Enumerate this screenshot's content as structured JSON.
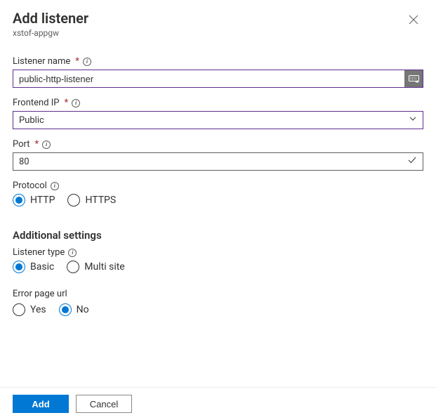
{
  "header": {
    "title": "Add listener",
    "subtitle": "xstof-appgw"
  },
  "fields": {
    "listenerName": {
      "label": "Listener name",
      "required": "*",
      "value": "public-http-listener"
    },
    "frontendIp": {
      "label": "Frontend IP",
      "required": "*",
      "value": "Public"
    },
    "port": {
      "label": "Port",
      "required": "*",
      "value": "80"
    },
    "protocol": {
      "label": "Protocol",
      "options": {
        "http": "HTTP",
        "https": "HTTPS"
      },
      "selected": "http"
    }
  },
  "section": {
    "heading": "Additional settings",
    "listenerType": {
      "label": "Listener type",
      "options": {
        "basic": "Basic",
        "multisite": "Multi site"
      },
      "selected": "basic"
    },
    "errorPageUrl": {
      "label": "Error page url",
      "options": {
        "yes": "Yes",
        "no": "No"
      },
      "selected": "no"
    }
  },
  "footer": {
    "add": "Add",
    "cancel": "Cancel"
  }
}
